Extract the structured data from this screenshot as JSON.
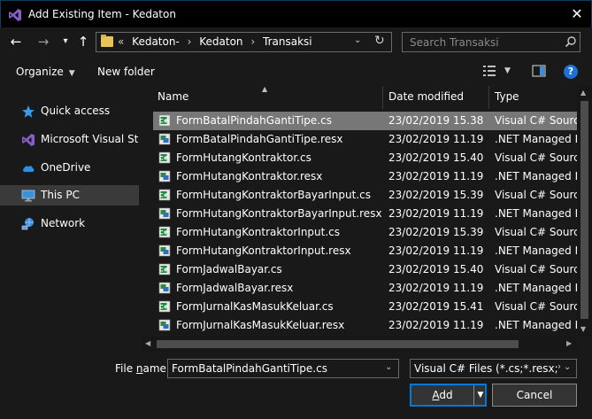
{
  "window": {
    "title": "Add Existing Item - Kedaton",
    "close_glyph": "✕"
  },
  "nav": {
    "back_glyph": "←",
    "forward_glyph": "→",
    "recent_glyph": "▾",
    "up_glyph": "↑",
    "breadcrumb_prefix": "«",
    "breadcrumbs": [
      "Kedaton-",
      "Kedaton",
      "Transaksi"
    ],
    "separator_glyph": "›",
    "refresh_glyph": "↻",
    "dropdown_glyph": "⌄",
    "search_placeholder": "Search Transaksi"
  },
  "toolbar": {
    "organize_label": "Organize",
    "new_folder_label": "New folder",
    "caret_glyph": "▼",
    "help_label": "?"
  },
  "sidebar": {
    "items": [
      {
        "label": "Quick access",
        "icon": "star-icon"
      },
      {
        "label": "Microsoft Visual Stud",
        "icon": "visual-studio-icon"
      },
      {
        "label": "OneDrive",
        "icon": "cloud-icon"
      },
      {
        "label": "This PC",
        "icon": "computer-icon",
        "selected": true
      },
      {
        "label": "Network",
        "icon": "network-icon"
      }
    ]
  },
  "columns": {
    "name": "Name",
    "date": "Date modified",
    "type": "Type",
    "sort_glyph": "▲"
  },
  "files": [
    {
      "name": "FormBatalPindahGantiTipe.cs",
      "date": "23/02/2019 15.38",
      "type": "Visual C# Source f",
      "kind": "cs",
      "selected": true
    },
    {
      "name": "FormBatalPindahGantiTipe.resx",
      "date": "23/02/2019 11.19",
      "type": ".NET Managed Re",
      "kind": "resx"
    },
    {
      "name": "FormHutangKontraktor.cs",
      "date": "23/02/2019 15.40",
      "type": "Visual C# Source f",
      "kind": "cs"
    },
    {
      "name": "FormHutangKontraktor.resx",
      "date": "23/02/2019 11.19",
      "type": ".NET Managed Re",
      "kind": "resx"
    },
    {
      "name": "FormHutangKontraktorBayarInput.cs",
      "date": "23/02/2019 15.39",
      "type": "Visual C# Source f",
      "kind": "cs"
    },
    {
      "name": "FormHutangKontraktorBayarInput.resx",
      "date": "23/02/2019 11.19",
      "type": ".NET Managed Re",
      "kind": "resx"
    },
    {
      "name": "FormHutangKontraktorInput.cs",
      "date": "23/02/2019 15.39",
      "type": "Visual C# Source f",
      "kind": "cs"
    },
    {
      "name": "FormHutangKontraktorInput.resx",
      "date": "23/02/2019 11.19",
      "type": ".NET Managed Re",
      "kind": "resx"
    },
    {
      "name": "FormJadwalBayar.cs",
      "date": "23/02/2019 15.40",
      "type": "Visual C# Source f",
      "kind": "cs"
    },
    {
      "name": "FormJadwalBayar.resx",
      "date": "23/02/2019 11.19",
      "type": ".NET Managed Re",
      "kind": "resx"
    },
    {
      "name": "FormJurnalKasMasukKeluar.cs",
      "date": "23/02/2019 15.41",
      "type": "Visual C# Source f",
      "kind": "cs"
    },
    {
      "name": "FormJurnalKasMasukKeluar.resx",
      "date": "23/02/2019 11.19",
      "type": ".NET Managed Re",
      "kind": "resx"
    }
  ],
  "scroll": {
    "up_glyph": "▲",
    "down_glyph": "▼",
    "left_glyph": "◀",
    "right_glyph": "▶"
  },
  "footer": {
    "file_name_label_pre": "File ",
    "file_name_label_accel": "n",
    "file_name_label_post": "ame:",
    "file_name_value": "FormBatalPindahGantiTipe.cs",
    "filter_value": "Visual C# Files (*.cs;*.resx;*.resw",
    "dropdown_glyph": "⌄",
    "add_label_accel": "A",
    "add_label_post": "dd",
    "add_dropdown_glyph": "▼",
    "cancel_label": "Cancel"
  },
  "colors": {
    "background": "#191919",
    "selection": "#777777",
    "accent": "#0078d7",
    "vs_purple": "#865fc5",
    "folder": "#e8c357"
  }
}
